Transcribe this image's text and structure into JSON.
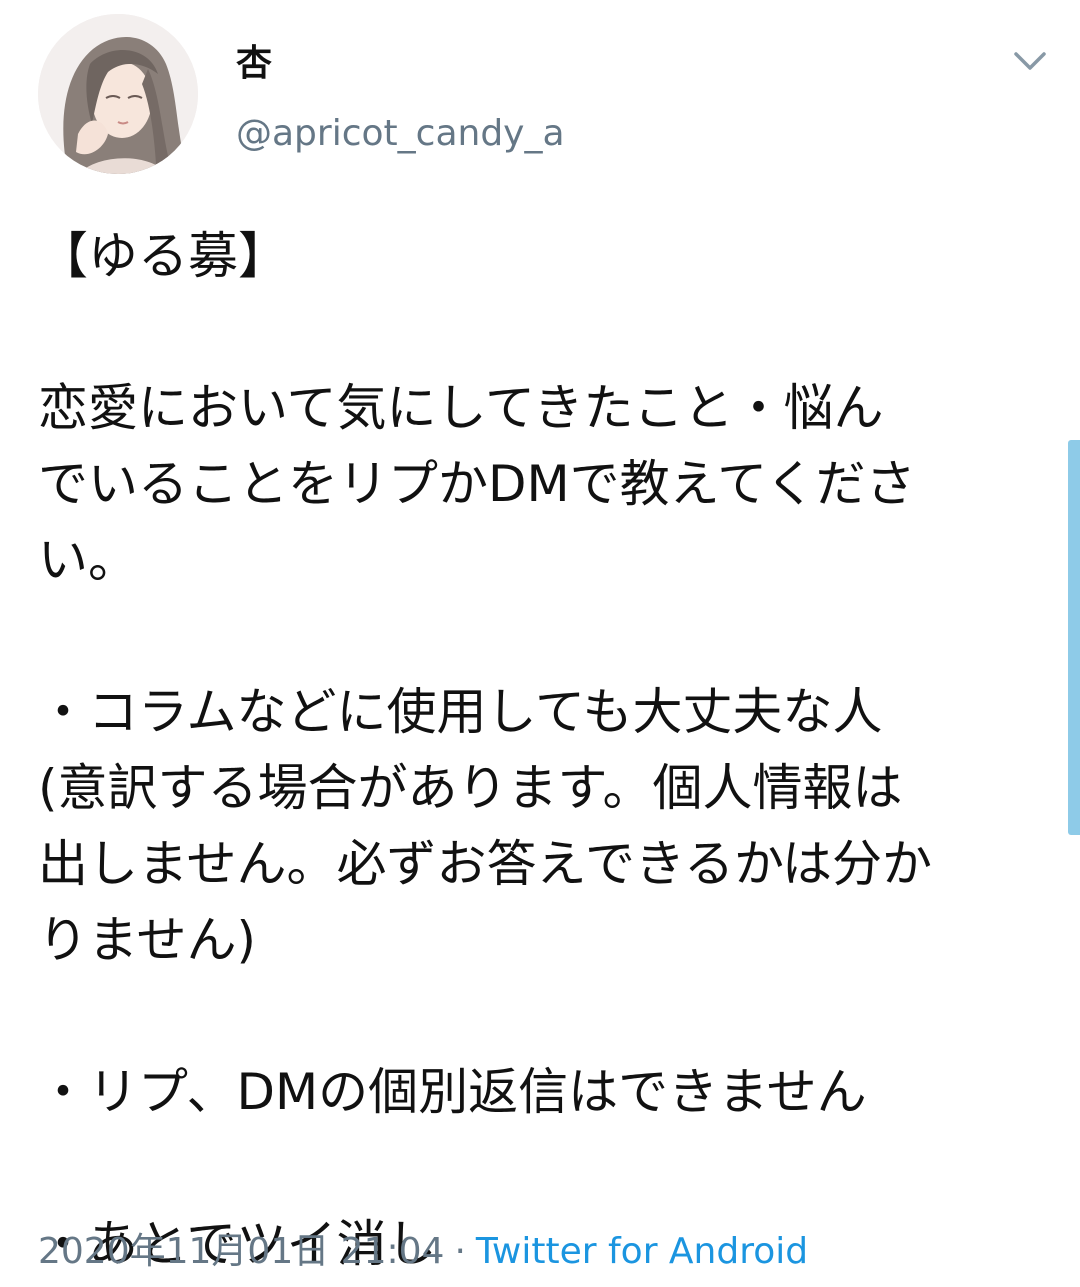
{
  "author": {
    "display_name": "杏",
    "handle": "@apricot_candy_a",
    "avatar_icon": "illustrated-woman-portrait"
  },
  "tweet": {
    "lines": [
      "【ゆる募】",
      "",
      "恋愛において気にしてきたこと・悩ん",
      "でいることをリプかDMで教えてくださ",
      "い。",
      "",
      "・コラムなどに使用しても大丈夫な人",
      "(意訳する場合があります。個人情報は",
      "出しません。必ずお答えできるかは分か",
      "りません)",
      "",
      "・リプ、DMの個別返信はできません",
      "",
      "・あとでツイ消し"
    ]
  },
  "meta": {
    "timestamp": "2020年11月01日 21:04",
    "separator": "·",
    "source": "Twitter for Android"
  },
  "colors": {
    "text": "#111111",
    "secondary": "#657786",
    "link": "#1b95e0",
    "scrollbar": "#8ecbe8"
  },
  "icons": {
    "menu": "chevron-down-icon"
  }
}
